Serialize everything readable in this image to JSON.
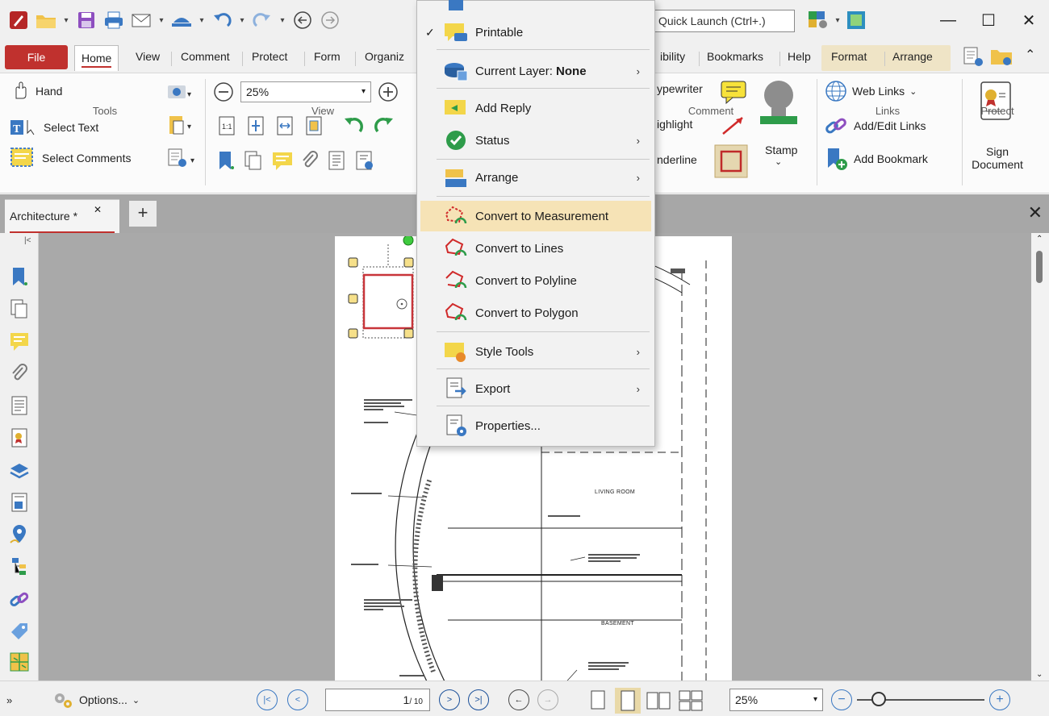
{
  "titlebar": {
    "quick_launch": "Quick Launch (Ctrl+.)"
  },
  "ribbon_tabs": [
    "File",
    "Home",
    "View",
    "Comment",
    "Protect",
    "Form",
    "Organiz",
    "ibility",
    "Bookmarks",
    "Help",
    "Format",
    "Arrange"
  ],
  "ribbon": {
    "tools": {
      "hand": "Hand",
      "select_text": "Select Text",
      "select_comments": "Select Comments",
      "label": "Tools"
    },
    "view": {
      "zoom": "25%",
      "label": "View"
    },
    "comment": {
      "typewriter": "ypewriter",
      "highlight": "ighlight",
      "underline": "nderline",
      "stamp": "Stamp",
      "label": "Comment"
    },
    "links": {
      "web_links": "Web Links",
      "add_edit_links": "Add/Edit Links",
      "add_bookmark": "Add Bookmark",
      "label": "Links"
    },
    "protect": {
      "sign_line1": "Sign",
      "sign_line2": "Document",
      "label": "Protect"
    }
  },
  "doc_tab": {
    "title": "Architecture *"
  },
  "context_menu": {
    "items": [
      {
        "label": "Printable",
        "checked": true
      },
      {
        "label": "Current Layer: ",
        "bold": "None",
        "submenu": true
      },
      {
        "label": "Add Reply"
      },
      {
        "label": "Status",
        "submenu": true
      },
      {
        "label": "Arrange",
        "submenu": true
      },
      {
        "label": "Convert to Measurement",
        "highlighted": true
      },
      {
        "label": "Convert to Lines"
      },
      {
        "label": "Convert to Polyline"
      },
      {
        "label": "Convert to Polygon"
      },
      {
        "label": "Style Tools",
        "submenu": true
      },
      {
        "label": "Export",
        "submenu": true
      },
      {
        "label": "Properties..."
      }
    ]
  },
  "plan_labels": {
    "living_room": "LIVING ROOM",
    "basement": "BASEMENT"
  },
  "statusbar": {
    "options": "Options...",
    "page_current": "1",
    "page_total": "/ 10",
    "zoom": "25%"
  },
  "colors": {
    "accent": "#c0312e",
    "menu_highlight": "#f6e3b6",
    "canvas": "#a9a9a9"
  }
}
